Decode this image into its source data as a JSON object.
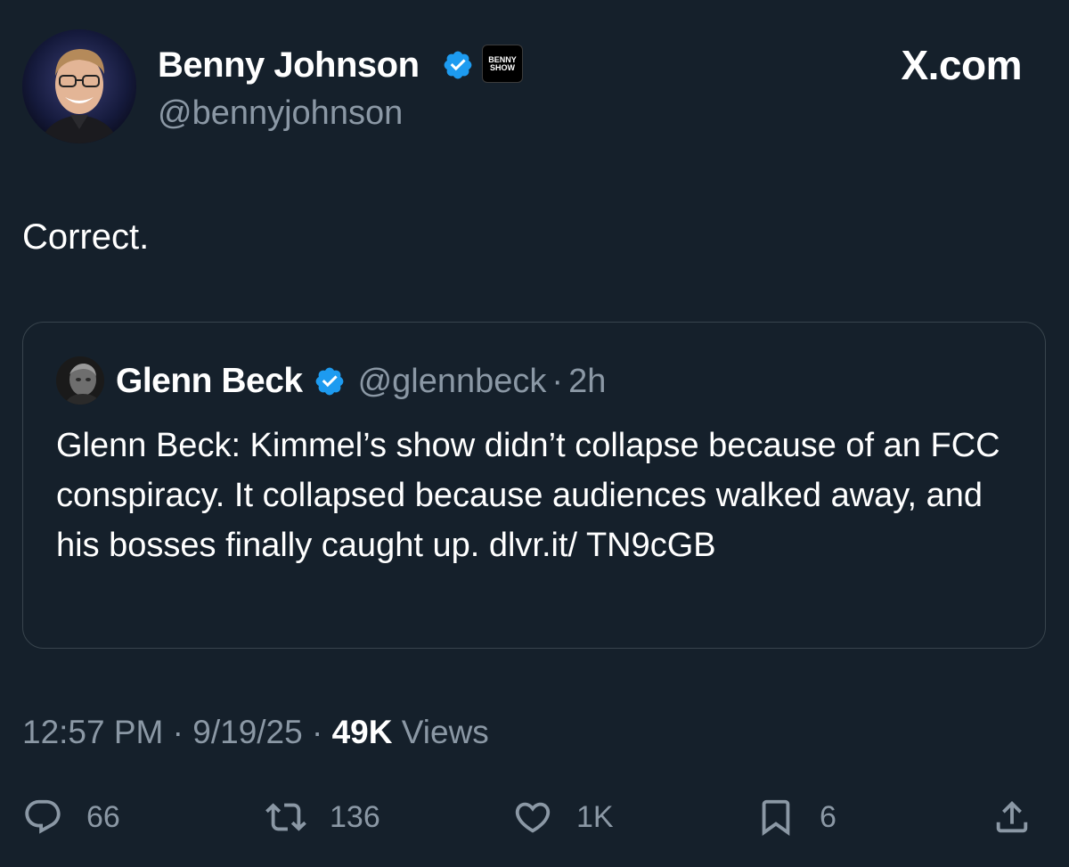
{
  "author": {
    "display_name": "Benny Johnson",
    "handle": "@bennyjohnson",
    "badge_text": [
      "BENNY",
      "SHOW"
    ]
  },
  "site_label": "X.com",
  "tweet": {
    "text": "Correct."
  },
  "quoted": {
    "display_name": "Glenn Beck",
    "handle": "@glennbeck",
    "separator": "·",
    "time": "2h",
    "text": "Glenn Beck: Kimmel’s show didn’t collapse because of an FCC conspiracy. It collapsed because audiences walked away, and his bosses finally caught up. dlvr.it/ TN9cGB"
  },
  "meta": {
    "time": "12:57 PM",
    "date": "9/19/25",
    "views_count": "49K",
    "views_label": "Views",
    "separator": "·"
  },
  "actions": {
    "replies": "66",
    "reposts": "136",
    "likes": "1K",
    "bookmarks": "6"
  },
  "colors": {
    "background": "#15202b",
    "text_primary": "#ffffff",
    "text_secondary": "#8b98a5",
    "verified_blue": "#1d9bf0",
    "border": "#38444d"
  }
}
